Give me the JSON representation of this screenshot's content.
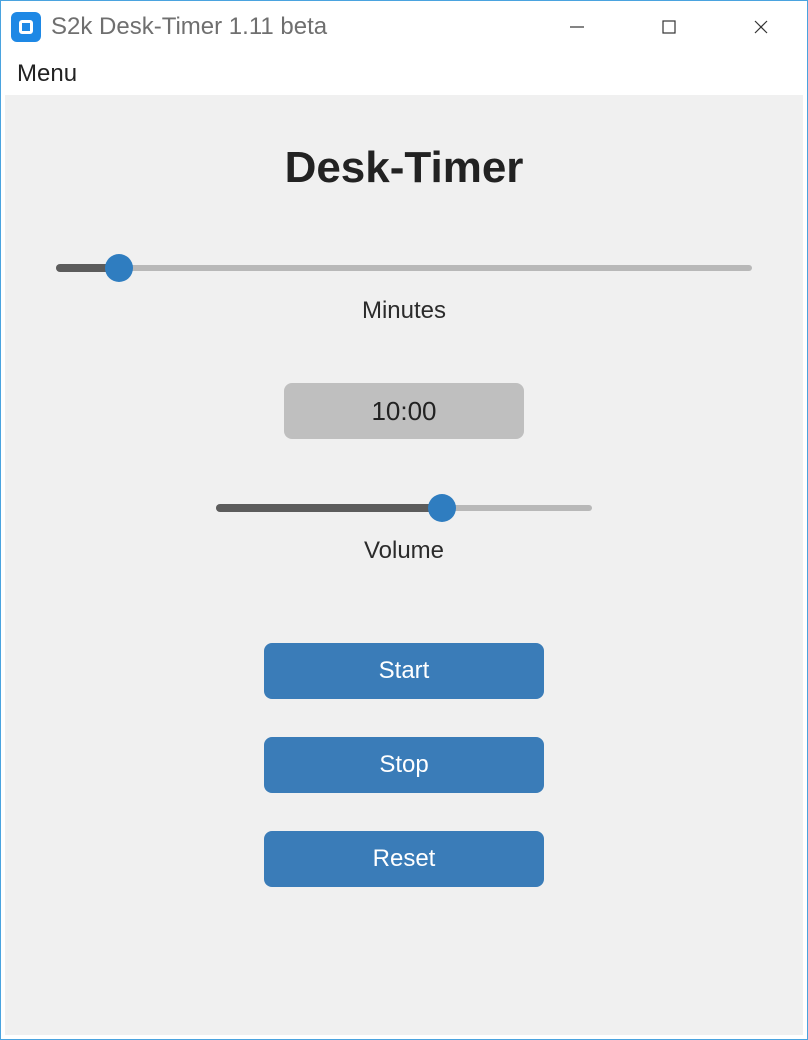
{
  "window": {
    "title": "S2k Desk-Timer 1.11 beta"
  },
  "menubar": {
    "menu_label": "Menu"
  },
  "main": {
    "heading": "Desk-Timer",
    "minutes_slider": {
      "label": "Minutes",
      "fill_percent": 9
    },
    "time_display": "10:00",
    "volume_slider": {
      "label": "Volume",
      "fill_percent": 60
    },
    "buttons": {
      "start": "Start",
      "stop": "Stop",
      "reset": "Reset"
    }
  },
  "colors": {
    "accent": "#3a7cb8",
    "slider_thumb": "#2f7dc0"
  }
}
